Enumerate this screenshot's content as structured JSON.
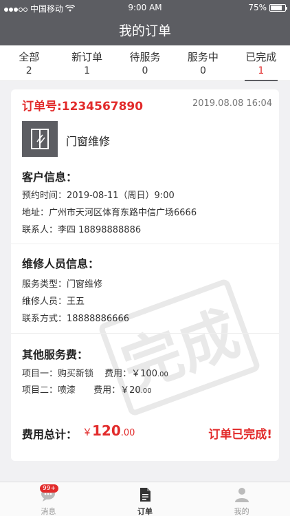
{
  "statusbar": {
    "carrier": "中国移动",
    "time": "9:00 AM",
    "battery": "75%"
  },
  "navbar": {
    "title": "我的订单"
  },
  "tabs": [
    {
      "label": "全部",
      "count": "2"
    },
    {
      "label": "新订单",
      "count": "1"
    },
    {
      "label": "待服务",
      "count": "0"
    },
    {
      "label": "服务中",
      "count": "0"
    },
    {
      "label": "已完成",
      "count": "1"
    }
  ],
  "order": {
    "number": "订单号:1234567890",
    "datetime": "2019.08.08  16:04",
    "service_name": "门窗维修",
    "customer": {
      "title": "客户信息：",
      "appointment": "预约时间：2019-08-11（周日）9:00",
      "address": "地址：广州市天河区体育东路中信广场6666",
      "contact": "联系人：李四    18898888886"
    },
    "repair": {
      "title": "维修人员信息：",
      "type": "服务类型：门窗维修",
      "person": "维修人员：王五",
      "phone": "联系方式：18888886666"
    },
    "fees": {
      "title": "其他服务费：",
      "item1_name": "项目一：购买新锁",
      "item1_fee": "费用：￥100",
      "item1_dec": ".00",
      "item2_name": "项目二：喷漆",
      "item2_fee": "费用：￥20",
      "item2_dec": ".00"
    },
    "total": {
      "label": "费用总计：",
      "symbol": "￥",
      "int": "120",
      "dec": ".00"
    },
    "status": "订单已完成!"
  },
  "watermark": "完成",
  "bottom": {
    "messages": "消息",
    "messages_badge": "99+",
    "orders": "订单",
    "mine": "我的"
  },
  "colors": {
    "header": "#5c5d62",
    "accent": "#e22b2b"
  }
}
